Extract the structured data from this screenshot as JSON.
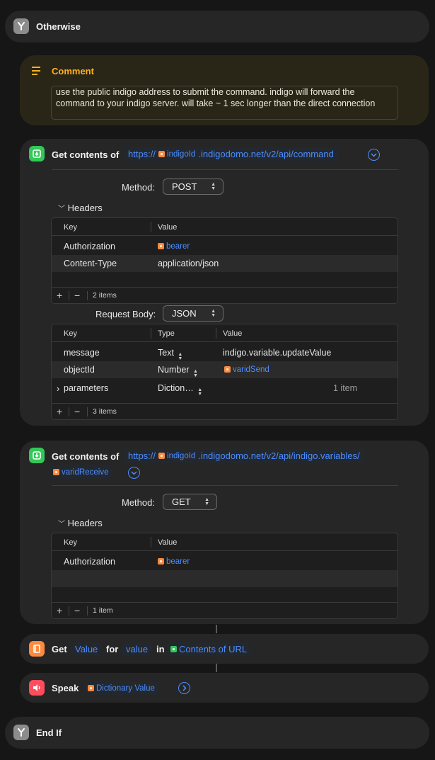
{
  "otherwise": {
    "title": "Otherwise",
    "icon": "branch-icon"
  },
  "comment": {
    "title": "Comment",
    "icon": "comment-lines-icon",
    "text": "use the public indigo address to submit the command. indigo will forward the command to your indigo server. will take ~ 1 sec longer than the direct connection"
  },
  "action1": {
    "title": "Get contents of",
    "icon": "download-icon",
    "url_prefix": "https://",
    "url_var": "indigoId",
    "url_suffix": ".indigodomo.net/v2/api/command",
    "method_label": "Method:",
    "method": "POST",
    "headers_label": "Headers",
    "headers_cols": [
      "Key",
      "Value"
    ],
    "headers_rows": [
      {
        "key": "Authorization",
        "value_var": "bearer"
      },
      {
        "key": "Content-Type",
        "value": "application/json"
      }
    ],
    "headers_count": "2 items",
    "body_label": "Request Body:",
    "body_type": "JSON",
    "body_cols": [
      "Key",
      "Type",
      "Value"
    ],
    "body_rows": [
      {
        "key": "message",
        "type": "Text",
        "value": "indigo.variable.updateValue"
      },
      {
        "key": "objectId",
        "type": "Number",
        "value_var": "varidSend"
      },
      {
        "key": "parameters",
        "type": "Diction…",
        "value": "1 item"
      }
    ],
    "body_count": "3 items"
  },
  "action2": {
    "title": "Get contents of",
    "icon": "download-icon",
    "url_prefix": "https://",
    "url_var": "indigoId",
    "url_suffix": ".indigodomo.net/v2/api/indigo.variables/",
    "url_var2": "varidReceive",
    "method_label": "Method:",
    "method": "GET",
    "headers_label": "Headers",
    "headers_cols": [
      "Key",
      "Value"
    ],
    "headers_rows": [
      {
        "key": "Authorization",
        "value_var": "bearer"
      }
    ],
    "headers_count": "1 item"
  },
  "action3": {
    "title": "Get",
    "icon": "book-icon",
    "param1": "Value",
    "for_label": "for",
    "param2": "value",
    "in_label": "in",
    "param3": "Contents of URL"
  },
  "action4": {
    "title": "Speak",
    "icon": "speaker-icon",
    "param": "Dictionary Value"
  },
  "endif": {
    "title": "End If",
    "icon": "branch-icon"
  },
  "colors": {
    "accent": "#4c8dff",
    "variable": "#ff8a3d",
    "green": "#34c759"
  }
}
